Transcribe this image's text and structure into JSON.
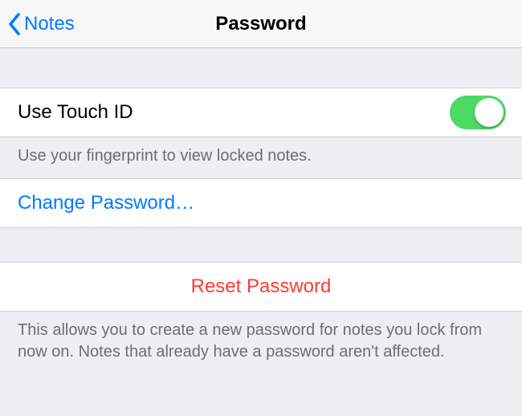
{
  "nav": {
    "back_label": "Notes",
    "title": "Password"
  },
  "touchid": {
    "label": "Use Touch ID",
    "enabled": true,
    "footer": "Use your fingerprint to view locked notes."
  },
  "change": {
    "label": "Change Password…"
  },
  "reset": {
    "label": "Reset Password",
    "footer": "This allows you to create a new password for notes you lock from now on. Notes that already have a password aren't affected."
  },
  "colors": {
    "accent": "#007aff",
    "destructive": "#ff3b30",
    "switch_on": "#4cd964"
  }
}
